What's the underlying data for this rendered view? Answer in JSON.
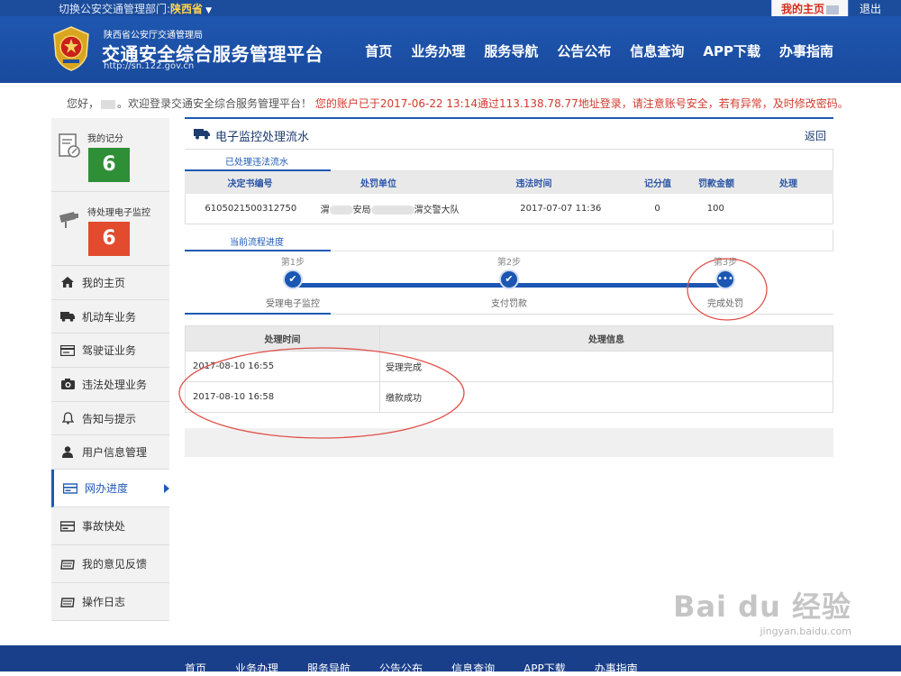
{
  "topbar": {
    "switch_label": "切换公安交通管理部门:",
    "province": "陕西省",
    "my_home": "我的主页",
    "logout": "退出"
  },
  "header": {
    "org": "陕西省公安厅交通管理局",
    "site_name": "交通安全综合服务管理平台",
    "url": "http://sn.122.gov.cn",
    "nav": [
      "首页",
      "业务办理",
      "服务导航",
      "公告公布",
      "信息查询",
      "APP下载",
      "办事指南"
    ]
  },
  "greeting": {
    "hello": "您好，",
    "welcome": "。欢迎登录交通安全综合服务管理平台！",
    "warning": "您的账户已于2017-06-22 13:14通过113.138.78.77地址登录，请注意账号安全，若有异常，及时修改密码。"
  },
  "sidebar": {
    "score_label": "我的记分",
    "score_value": "6",
    "pending_label": "待处理电子监控",
    "pending_value": "6",
    "items": [
      {
        "label": "我的主页",
        "icon": "home-icon"
      },
      {
        "label": "机动车业务",
        "icon": "truck-icon"
      },
      {
        "label": "驾驶证业务",
        "icon": "card-icon"
      },
      {
        "label": "违法处理业务",
        "icon": "camera-icon"
      },
      {
        "label": "告知与提示",
        "icon": "bell-icon"
      },
      {
        "label": "用户信息管理",
        "icon": "user-icon"
      },
      {
        "label": "网办进度",
        "icon": "progress-icon"
      },
      {
        "label": "事故快处",
        "icon": "accident-icon"
      },
      {
        "label": "我的意见反馈",
        "icon": "feedback-icon"
      },
      {
        "label": "操作日志",
        "icon": "log-icon"
      }
    ]
  },
  "main": {
    "title": "电子监控处理流水",
    "back": "返回",
    "processed_tab": "已处理违法流水",
    "table_headers": [
      "决定书编号",
      "处罚单位",
      "违法时间",
      "记分值",
      "罚款金额",
      "处理"
    ],
    "row": {
      "doc_no": "6105021500312750",
      "unit_a": "渭",
      "unit_b": "安局",
      "unit_c": "渭交警大队",
      "time": "2017-07-07 11:36",
      "points": "0",
      "fine": "100",
      "action": ""
    },
    "progress_tab": "当前流程进度",
    "steps": [
      {
        "step": "第1步",
        "name": "受理电子监控",
        "state": "done"
      },
      {
        "step": "第2步",
        "name": "支付罚款",
        "state": "done"
      },
      {
        "step": "第3步",
        "name": "完成处罚",
        "state": "current"
      }
    ],
    "proc_headers": [
      "处理时间",
      "处理信息"
    ],
    "proc_rows": [
      {
        "time": "2017-08-10 16:55",
        "info": "受理完成"
      },
      {
        "time": "2017-08-10 16:58",
        "info": "缴款成功"
      }
    ]
  },
  "footer": {
    "nav": [
      "首页",
      "业务办理",
      "服务导航",
      "公告公布",
      "信息查询",
      "APP下载",
      "办事指南"
    ]
  },
  "watermark": {
    "brand": "Bai du 经验",
    "url": "jingyan.baidu.com"
  },
  "colors": {
    "brand_blue": "#1d5ab3",
    "header_blue": "#1f57b0",
    "score_green": "#2f8f37",
    "pending_red": "#e24b2d",
    "warning_red": "#d33a2c"
  }
}
